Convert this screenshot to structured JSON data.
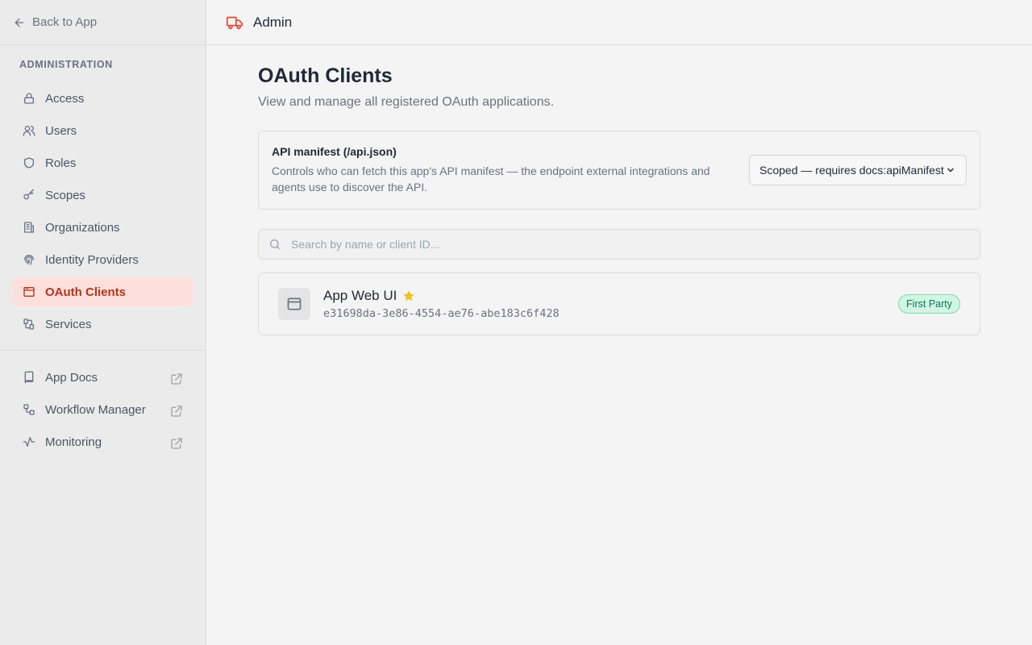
{
  "sidebar": {
    "back_label": "Back to App",
    "section_title": "ADMINISTRATION",
    "items": [
      {
        "label": "Access",
        "icon": "lock-icon"
      },
      {
        "label": "Users",
        "icon": "users-icon"
      },
      {
        "label": "Roles",
        "icon": "shield-icon"
      },
      {
        "label": "Scopes",
        "icon": "key-icon"
      },
      {
        "label": "Organizations",
        "icon": "building-icon"
      },
      {
        "label": "Identity Providers",
        "icon": "fingerprint-icon"
      },
      {
        "label": "OAuth Clients",
        "icon": "app-window-icon",
        "active": true
      },
      {
        "label": "Services",
        "icon": "services-icon"
      }
    ],
    "external_links": [
      {
        "label": "App Docs",
        "icon": "book-icon"
      },
      {
        "label": "Workflow Manager",
        "icon": "workflow-icon"
      },
      {
        "label": "Monitoring",
        "icon": "activity-icon"
      }
    ]
  },
  "header": {
    "title": "Admin",
    "logo_icon": "truck-icon",
    "accent_color": "#e0533d"
  },
  "main": {
    "title": "OAuth Clients",
    "subtitle": "View and manage all registered OAuth applications.",
    "manifest": {
      "heading": "API manifest (/api.json)",
      "description": "Controls who can fetch this app's API manifest — the endpoint external integrations and agents use to discover the API.",
      "selected_option": "Scoped — requires docs:apiManifest"
    },
    "search": {
      "placeholder": "Search by name or client ID..."
    },
    "clients": [
      {
        "name": "App Web UI",
        "client_id": "e31698da-3e86-4554-ae76-abe183c6f428",
        "badge": "First Party",
        "starred": true
      }
    ]
  }
}
